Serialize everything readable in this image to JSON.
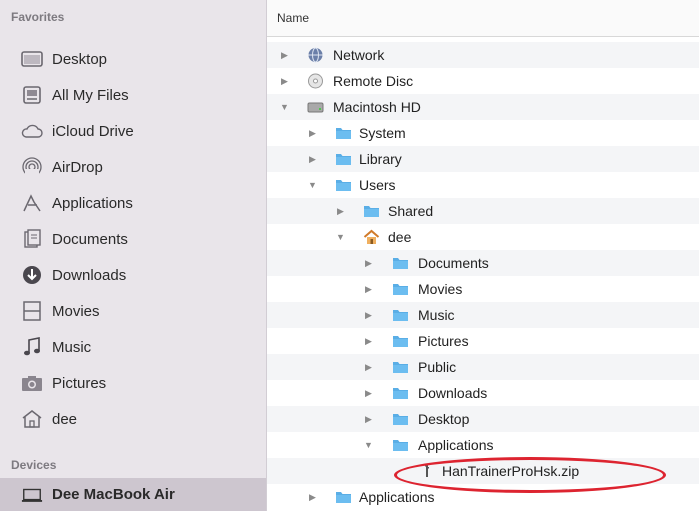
{
  "sidebar": {
    "favorites_heading": "Favorites",
    "devices_heading": "Devices",
    "favorites": [
      {
        "label": "Desktop",
        "icon": "desktop-icon"
      },
      {
        "label": "All My Files",
        "icon": "all-my-files-icon"
      },
      {
        "label": "iCloud Drive",
        "icon": "cloud-icon"
      },
      {
        "label": "AirDrop",
        "icon": "airdrop-icon"
      },
      {
        "label": "Applications",
        "icon": "applications-icon"
      },
      {
        "label": "Documents",
        "icon": "documents-icon"
      },
      {
        "label": "Downloads",
        "icon": "downloads-icon"
      },
      {
        "label": "Movies",
        "icon": "movies-icon"
      },
      {
        "label": "Music",
        "icon": "music-icon"
      },
      {
        "label": "Pictures",
        "icon": "pictures-icon"
      },
      {
        "label": "dee",
        "icon": "home-icon"
      }
    ],
    "devices": [
      {
        "label": "Dee MacBook Air",
        "icon": "laptop-icon",
        "selected": true
      }
    ]
  },
  "main": {
    "column_header": "Name",
    "rows": [
      {
        "name": "Network",
        "icon": "network-icon",
        "expanded": false
      },
      {
        "name": "Remote Disc",
        "icon": "remote-disc-icon",
        "expanded": false
      },
      {
        "name": "Macintosh HD",
        "icon": "hard-drive-icon",
        "expanded": true
      },
      {
        "name": "System",
        "icon": "folder-icon",
        "expanded": false
      },
      {
        "name": "Library",
        "icon": "folder-icon",
        "expanded": false
      },
      {
        "name": "Users",
        "icon": "folder-icon",
        "expanded": true
      },
      {
        "name": "Shared",
        "icon": "folder-icon",
        "expanded": false
      },
      {
        "name": "dee",
        "icon": "home-folder-icon",
        "expanded": true
      },
      {
        "name": "Documents",
        "icon": "folder-icon",
        "expanded": false
      },
      {
        "name": "Movies",
        "icon": "folder-icon",
        "expanded": false
      },
      {
        "name": "Music",
        "icon": "folder-icon",
        "expanded": false
      },
      {
        "name": "Pictures",
        "icon": "folder-icon",
        "expanded": false
      },
      {
        "name": "Public",
        "icon": "folder-icon",
        "expanded": false
      },
      {
        "name": "Downloads",
        "icon": "folder-icon",
        "expanded": false
      },
      {
        "name": "Desktop",
        "icon": "folder-icon",
        "expanded": false
      },
      {
        "name": "Applications",
        "icon": "folder-icon",
        "expanded": true
      },
      {
        "name": "HanTrainerProHsk.zip",
        "icon": "zip-file-icon",
        "highlighted": true
      },
      {
        "name": "Applications",
        "icon": "folder-icon",
        "expanded": false
      }
    ]
  },
  "colors": {
    "sidebar_bg": "#e9e5ea",
    "selection_bg": "#cdc6cf",
    "folder_blue": "#5aaee6",
    "highlight_ring": "#dd2430"
  }
}
